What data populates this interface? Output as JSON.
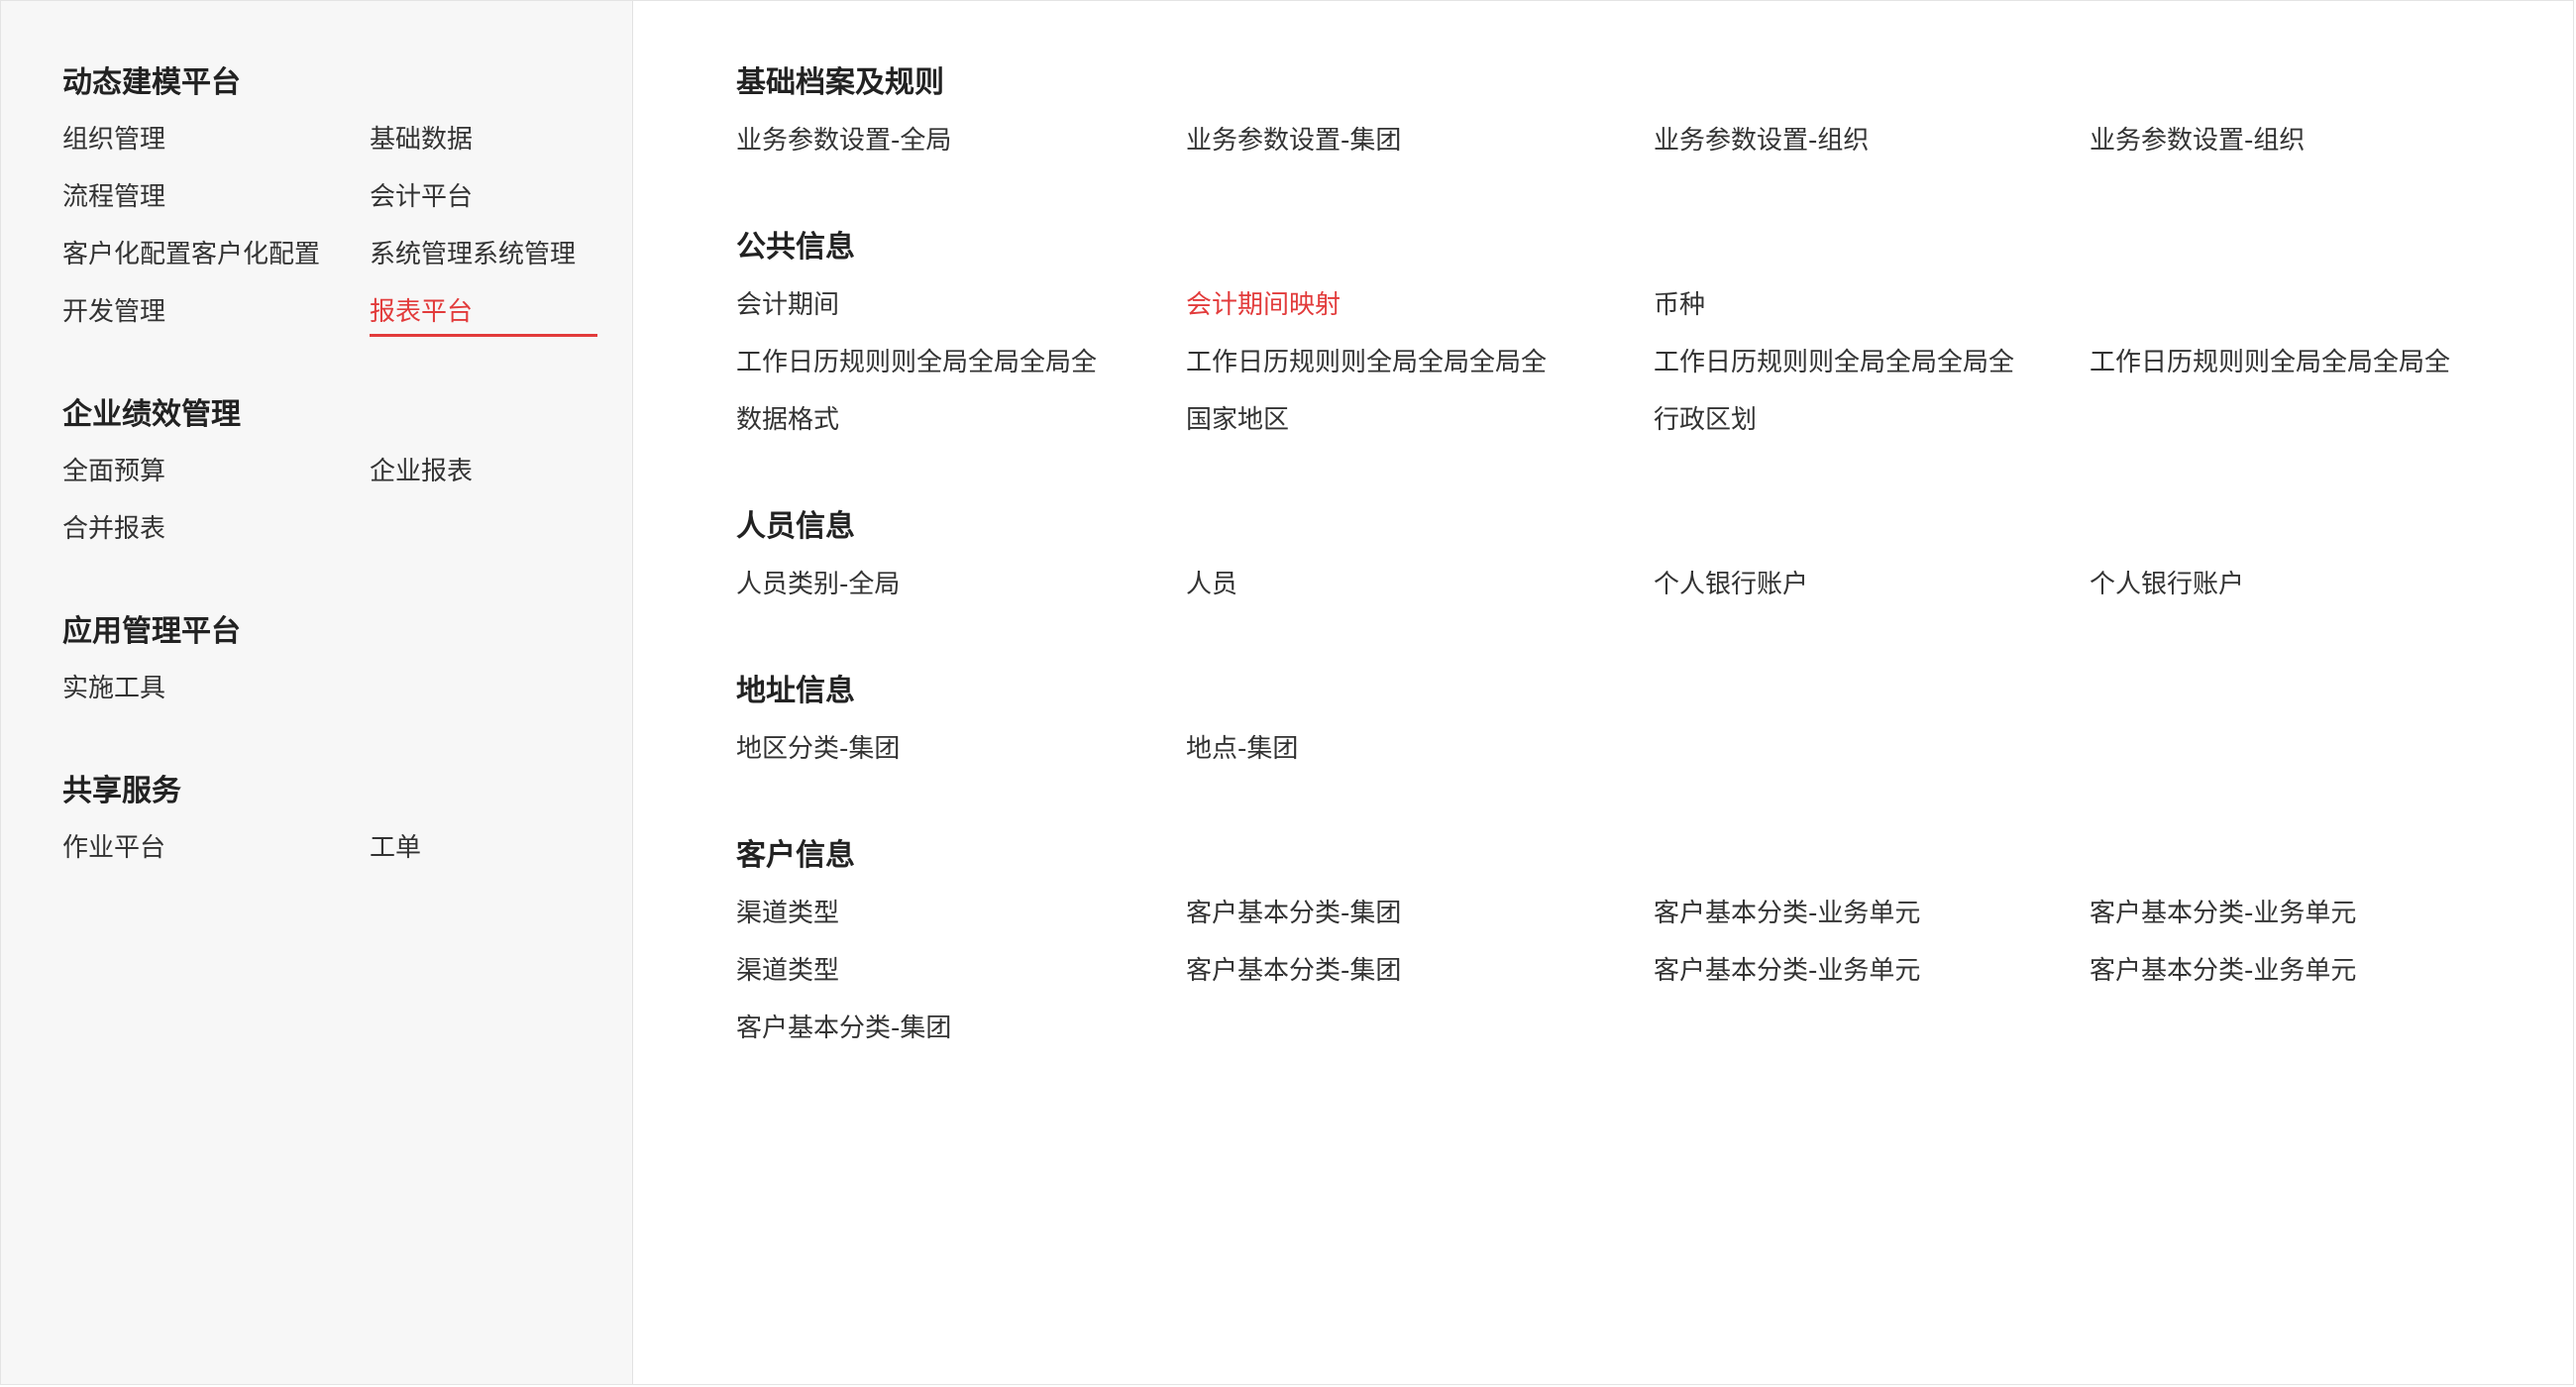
{
  "accent_color": "#e23b3b",
  "sidebar": {
    "groups": [
      {
        "title": "动态建模平台",
        "items": [
          {
            "label": "组织管理"
          },
          {
            "label": "基础数据"
          },
          {
            "label": "流程管理"
          },
          {
            "label": "会计平台"
          },
          {
            "label": "客户化配置客户化配置"
          },
          {
            "label": "系统管理系统管理"
          },
          {
            "label": "开发管理"
          },
          {
            "label": "报表平台",
            "active": true
          }
        ]
      },
      {
        "title": "企业绩效管理",
        "items": [
          {
            "label": "全面预算"
          },
          {
            "label": "企业报表"
          },
          {
            "label": "合并报表"
          }
        ]
      },
      {
        "title": "应用管理平台",
        "items": [
          {
            "label": "实施工具"
          }
        ]
      },
      {
        "title": "共享服务",
        "items": [
          {
            "label": "作业平台"
          },
          {
            "label": "工单"
          }
        ]
      }
    ]
  },
  "content": {
    "sections": [
      {
        "title": "基础档案及规则",
        "items": [
          {
            "label": "业务参数设置-全局"
          },
          {
            "label": "业务参数设置-集团"
          },
          {
            "label": "业务参数设置-组织"
          },
          {
            "label": "业务参数设置-组织"
          }
        ]
      },
      {
        "title": "公共信息",
        "items": [
          {
            "label": "会计期间"
          },
          {
            "label": "会计期间映射",
            "active": true
          },
          {
            "label": "币种"
          },
          {
            "label": ""
          },
          {
            "label": "工作日历规则则全局全局全局全"
          },
          {
            "label": "工作日历规则则全局全局全局全"
          },
          {
            "label": "工作日历规则则全局全局全局全"
          },
          {
            "label": "工作日历规则则全局全局全局全"
          },
          {
            "label": "数据格式"
          },
          {
            "label": "国家地区"
          },
          {
            "label": "行政区划"
          }
        ]
      },
      {
        "title": "人员信息",
        "items": [
          {
            "label": "人员类别-全局"
          },
          {
            "label": "人员"
          },
          {
            "label": "个人银行账户"
          },
          {
            "label": "个人银行账户"
          }
        ]
      },
      {
        "title": "地址信息",
        "items": [
          {
            "label": "地区分类-集团"
          },
          {
            "label": "地点-集团"
          }
        ]
      },
      {
        "title": "客户信息",
        "items": [
          {
            "label": "渠道类型"
          },
          {
            "label": "客户基本分类-集团"
          },
          {
            "label": "客户基本分类-业务单元"
          },
          {
            "label": "客户基本分类-业务单元"
          },
          {
            "label": "渠道类型"
          },
          {
            "label": "客户基本分类-集团"
          },
          {
            "label": "客户基本分类-业务单元"
          },
          {
            "label": "客户基本分类-业务单元"
          },
          {
            "label": "客户基本分类-集团"
          }
        ]
      }
    ]
  }
}
